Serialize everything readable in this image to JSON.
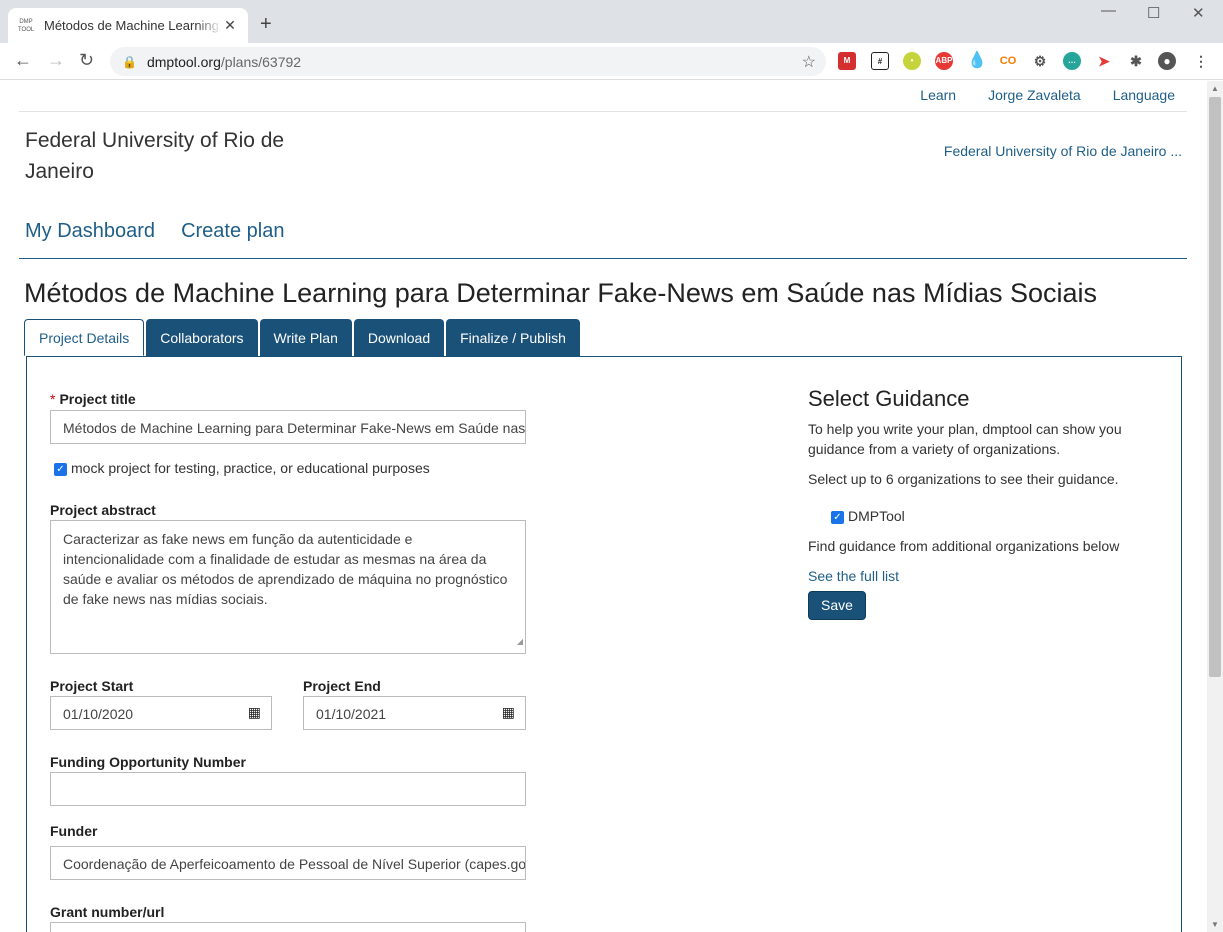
{
  "browser": {
    "tab_title": "Métodos de Machine Learning para Determinar Fake-News em Saúde nas Mídias Sociais",
    "tab_favicon": "DMP TOOL",
    "url_host": "dmptool.org",
    "url_path": "/plans/63792"
  },
  "topnav": {
    "learn": "Learn",
    "user": "Jorge Zavaleta",
    "language": "Language"
  },
  "org": {
    "name": "Federal University of Rio de Janeiro",
    "link": "Federal University of Rio de Janeiro ..."
  },
  "mainnav": {
    "dashboard": "My Dashboard",
    "create": "Create plan"
  },
  "plan": {
    "title": "Métodos de Machine Learning para Determinar Fake-News em Saúde nas Mídias Sociais"
  },
  "tabs": [
    "Project Details",
    "Collaborators",
    "Write Plan",
    "Download",
    "Finalize / Publish"
  ],
  "form": {
    "required_mark": "*",
    "project_title_label": "Project title",
    "project_title_value": "Métodos de Machine Learning para Determinar Fake-News em Saúde nas Mídias Sociais",
    "mock_label": "mock project for testing, practice, or educational purposes",
    "mock_checked": true,
    "abstract_label": "Project abstract",
    "abstract_value": "Caracterizar as fake news em função da autenticidade e intencionalidade com a finalidade de estudar as mesmas na área da saúde e avaliar os métodos de aprendizado de máquina no prognóstico de fake news nas mídias sociais.",
    "start_label": "Project Start",
    "start_value": "01/10/2020",
    "end_label": "Project End",
    "end_value": "01/10/2021",
    "funding_label": "Funding Opportunity Number",
    "funding_value": "",
    "funder_label": "Funder",
    "funder_value": "Coordenação de Aperfeicoamento de Pessoal de Nível Superior (capes.gov.br)",
    "grant_label": "Grant number/url"
  },
  "guidance": {
    "heading": "Select Guidance",
    "intro": "To help you write your plan, dmptool can show you guidance from a variety of organizations.",
    "select_text": "Select up to 6 organizations to see their guidance.",
    "org_option": "DMPTool",
    "org_checked": true,
    "find_text": "Find guidance from additional organizations below",
    "full_list_link": "See the full list",
    "save_label": "Save"
  },
  "colors": {
    "brand": "#1a5179",
    "link": "#1f5e87"
  }
}
